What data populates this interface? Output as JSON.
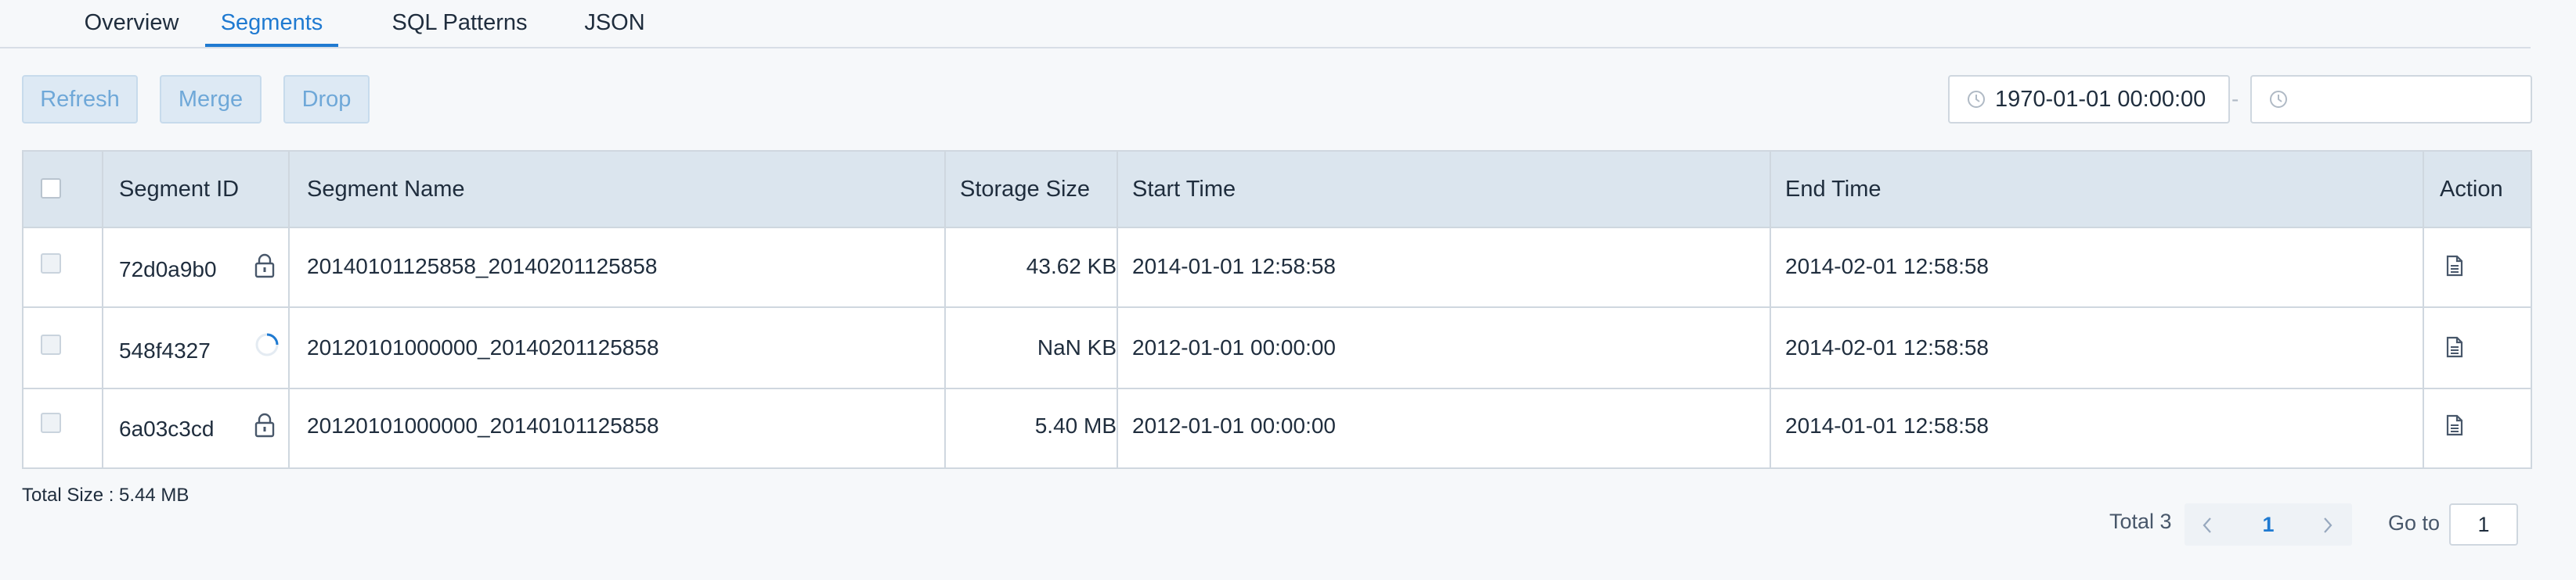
{
  "tabs": [
    {
      "label": "Overview",
      "active": false
    },
    {
      "label": "Segments",
      "active": true
    },
    {
      "label": "SQL Patterns",
      "active": false
    },
    {
      "label": "JSON",
      "active": false
    }
  ],
  "toolbar": {
    "refresh_label": "Refresh",
    "merge_label": "Merge",
    "drop_label": "Drop"
  },
  "date_range": {
    "start": "1970-01-01 00:00:00",
    "separator": "-",
    "end": ""
  },
  "table": {
    "columns": [
      "Segment ID",
      "Segment Name",
      "Storage Size",
      "Start Time",
      "End Time",
      "Action"
    ],
    "rows": [
      {
        "id": "72d0a9b0",
        "status_icon": "lock-icon",
        "name": "20140101125858_20140201125858",
        "size": "43.62 KB",
        "start": "2014-01-01 12:58:58",
        "end": "2014-02-01 12:58:58",
        "action_icon": "document-icon"
      },
      {
        "id": "548f4327",
        "status_icon": "loading-spinner-icon",
        "name": "20120101000000_20140201125858",
        "size": "NaN KB",
        "start": "2012-01-01 00:00:00",
        "end": "2014-02-01 12:58:58",
        "action_icon": "document-icon"
      },
      {
        "id": "6a03c3cd",
        "status_icon": "lock-icon",
        "name": "20120101000000_20140101125858",
        "size": "5.40 MB",
        "start": "2012-01-01 00:00:00",
        "end": "2014-01-01 12:58:58",
        "action_icon": "document-icon"
      }
    ]
  },
  "total_size": "Total Size : 5.44 MB",
  "pagination": {
    "total_label": "Total 3",
    "current_page": "1",
    "goto_label": "Go to",
    "goto_value": "1"
  },
  "colors": {
    "accent": "#1f7ad1",
    "header_bg": "#dbe5ee",
    "button_bg": "#dde9f4",
    "button_text": "#6fa8d8"
  }
}
